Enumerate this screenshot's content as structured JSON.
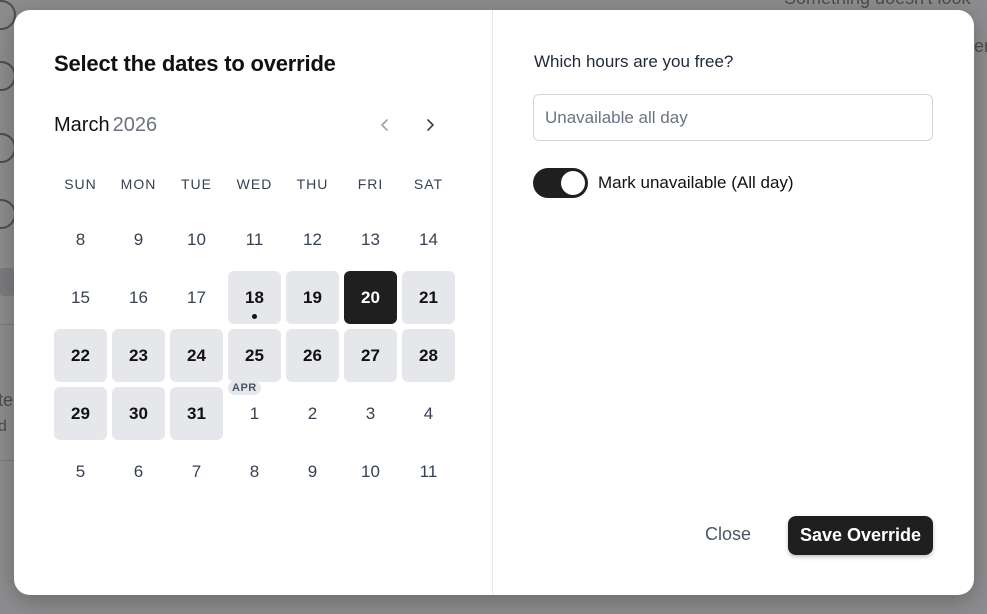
{
  "background": {
    "snippet_top_right": "Something doesn't look",
    "snippet_right": "er",
    "snippet_left_1": "te",
    "snippet_left_2": "d"
  },
  "modal": {
    "title": "Select the dates to override",
    "calendar": {
      "month": "March",
      "year": "2026",
      "prev_icon": "chevron-left-icon",
      "next_icon": "chevron-right-icon",
      "weekdays": [
        "SUN",
        "MON",
        "TUE",
        "WED",
        "THU",
        "FRI",
        "SAT"
      ],
      "days": [
        {
          "label": "8",
          "state": "disabled"
        },
        {
          "label": "9",
          "state": "disabled"
        },
        {
          "label": "10",
          "state": "disabled"
        },
        {
          "label": "11",
          "state": "disabled"
        },
        {
          "label": "12",
          "state": "disabled"
        },
        {
          "label": "13",
          "state": "disabled"
        },
        {
          "label": "14",
          "state": "disabled"
        },
        {
          "label": "15",
          "state": "disabled"
        },
        {
          "label": "16",
          "state": "disabled"
        },
        {
          "label": "17",
          "state": "disabled"
        },
        {
          "label": "18",
          "state": "available",
          "today": true
        },
        {
          "label": "19",
          "state": "available"
        },
        {
          "label": "20",
          "state": "selected"
        },
        {
          "label": "21",
          "state": "available"
        },
        {
          "label": "22",
          "state": "available"
        },
        {
          "label": "23",
          "state": "available"
        },
        {
          "label": "24",
          "state": "available"
        },
        {
          "label": "25",
          "state": "available"
        },
        {
          "label": "26",
          "state": "available"
        },
        {
          "label": "27",
          "state": "available"
        },
        {
          "label": "28",
          "state": "available"
        },
        {
          "label": "29",
          "state": "available"
        },
        {
          "label": "30",
          "state": "available"
        },
        {
          "label": "31",
          "state": "available"
        },
        {
          "label": "1",
          "state": "disabled",
          "month_tag": "APR"
        },
        {
          "label": "2",
          "state": "disabled"
        },
        {
          "label": "3",
          "state": "disabled"
        },
        {
          "label": "4",
          "state": "disabled"
        },
        {
          "label": "5",
          "state": "disabled"
        },
        {
          "label": "6",
          "state": "disabled"
        },
        {
          "label": "7",
          "state": "disabled"
        },
        {
          "label": "8",
          "state": "disabled"
        },
        {
          "label": "9",
          "state": "disabled"
        },
        {
          "label": "10",
          "state": "disabled"
        },
        {
          "label": "11",
          "state": "disabled"
        }
      ]
    },
    "hours": {
      "question": "Which hours are you free?",
      "input_value": "",
      "input_placeholder": "Unavailable all day"
    },
    "unavailable_toggle": {
      "label": "Mark unavailable (All day)",
      "checked": true
    },
    "buttons": {
      "close": "Close",
      "save": "Save Override"
    }
  }
}
